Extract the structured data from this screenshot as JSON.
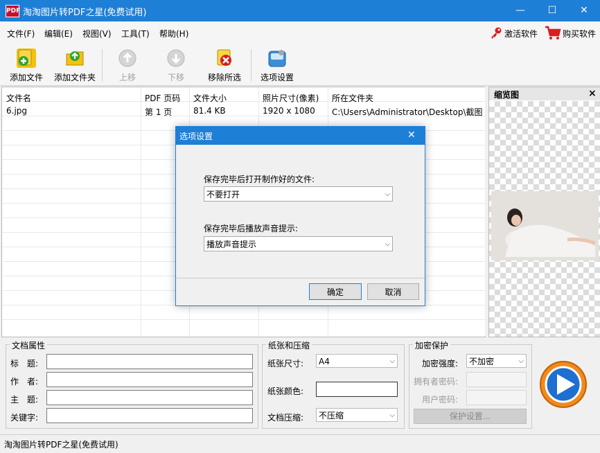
{
  "window": {
    "title": "淘淘图片转PDF之星(免费试用)",
    "app_icon": "PDF",
    "minimize": "—",
    "maximize": "☐",
    "close": "✕"
  },
  "menu": [
    {
      "label": "文件(F)"
    },
    {
      "label": "编辑(E)"
    },
    {
      "label": "视图(V)"
    },
    {
      "label": "工具(T)"
    },
    {
      "label": "帮助(H)"
    }
  ],
  "menu_right": {
    "activate": "激活软件",
    "buy": "购买软件"
  },
  "toolbar": [
    {
      "label": "添加文件",
      "icon": "add-file-icon"
    },
    {
      "label": "添加文件夹",
      "icon": "add-folder-icon"
    },
    {
      "label": "上移",
      "icon": "move-up-icon"
    },
    {
      "label": "下移",
      "icon": "move-down-icon"
    },
    {
      "label": "移除所选",
      "icon": "remove-selected-icon"
    },
    {
      "label": "选项设置",
      "icon": "options-icon"
    }
  ],
  "table": {
    "columns": [
      "文件名",
      "PDF 页码",
      "文件大小",
      "照片尺寸(像素)",
      "所在文件夹"
    ],
    "rows": [
      [
        "6.jpg",
        "第 1 页",
        "81.4 KB",
        "1920 x 1080",
        "C:\\Users\\Administrator\\Desktop\\截图..."
      ]
    ]
  },
  "preview": {
    "title": "缩览图",
    "close": "×"
  },
  "doc_props": {
    "legend": "文档属性",
    "title_label": "标　题:",
    "author_label": "作　者:",
    "subject_label": "主　题:",
    "keywords_label": "关键字:",
    "title_value": "",
    "author_value": "",
    "subject_value": "",
    "keywords_value": ""
  },
  "paper": {
    "legend": "纸张和压缩",
    "size_label": "纸张尺寸:",
    "size_value": "A4",
    "color_label": "纸张颜色:",
    "compress_label": "文档压缩:",
    "compress_value": "不压缩"
  },
  "encrypt": {
    "legend": "加密保护",
    "strength_label": "加密强度:",
    "strength_value": "不加密",
    "owner_label": "拥有者密码:",
    "user_label": "用户密码:",
    "protect_button": "保护设置..."
  },
  "status": {
    "text": "淘淘图片转PDF之星(免费试用)"
  },
  "dialog": {
    "title": "选项设置",
    "close": "✕",
    "open_label": "保存完毕后打开制作好的文件:",
    "open_value": "不要打开",
    "sound_label": "保存完毕后播放声音提示:",
    "sound_value": "播放声音提示",
    "ok": "确定",
    "cancel": "取消"
  },
  "colors": {
    "accent": "#1e7fd6",
    "titlebar": "#1e7fd6"
  }
}
